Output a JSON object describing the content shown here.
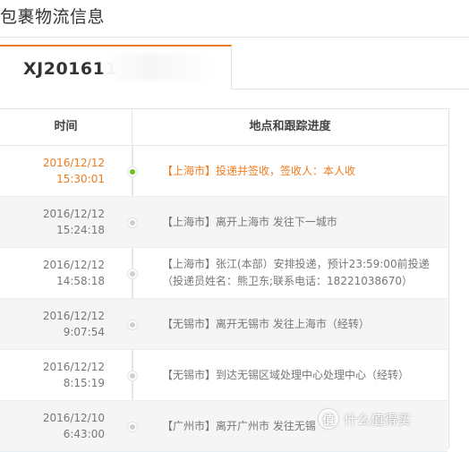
{
  "page": {
    "title": "包裹物流信息"
  },
  "tab": {
    "tracking_prefix": "XJ201611"
  },
  "table": {
    "headers": {
      "time": "时间",
      "location": "地点和跟踪进度"
    },
    "rows": [
      {
        "date": "2016/12/12",
        "time": "15:30:01",
        "line1": "【上海市】投递并签收，签收人：本人收",
        "line2": "",
        "active": true
      },
      {
        "date": "2016/12/12",
        "time": "15:24:18",
        "line1": "【上海市】离开上海市 发往下一城市",
        "line2": "",
        "active": false
      },
      {
        "date": "2016/12/12",
        "time": "14:58:18",
        "line1": "【上海市】张江(本部）安排投递，预计23:59:00前投递",
        "line2": "（投递员姓名：熊卫东;联系电话：18221038670）",
        "active": false
      },
      {
        "date": "2016/12/12",
        "time": "9:07:54",
        "line1": "【无锡市】离开无锡市 发往上海市（经转）",
        "line2": "",
        "active": false
      },
      {
        "date": "2016/12/12",
        "time": "8:15:19",
        "line1": "【无锡市】到达无锡区域处理中心处理中心（经转）",
        "line2": "",
        "active": false
      },
      {
        "date": "2016/12/10",
        "time": "6:43:00",
        "line1": "【广州市】离开广州市 发往无锡",
        "line2": "",
        "active": false
      }
    ]
  },
  "watermark": {
    "logo_glyph": "值",
    "text": "什么值得买"
  },
  "colors": {
    "accent": "#f07c1e",
    "active_dot": "#6cc417",
    "text": "#666666"
  }
}
